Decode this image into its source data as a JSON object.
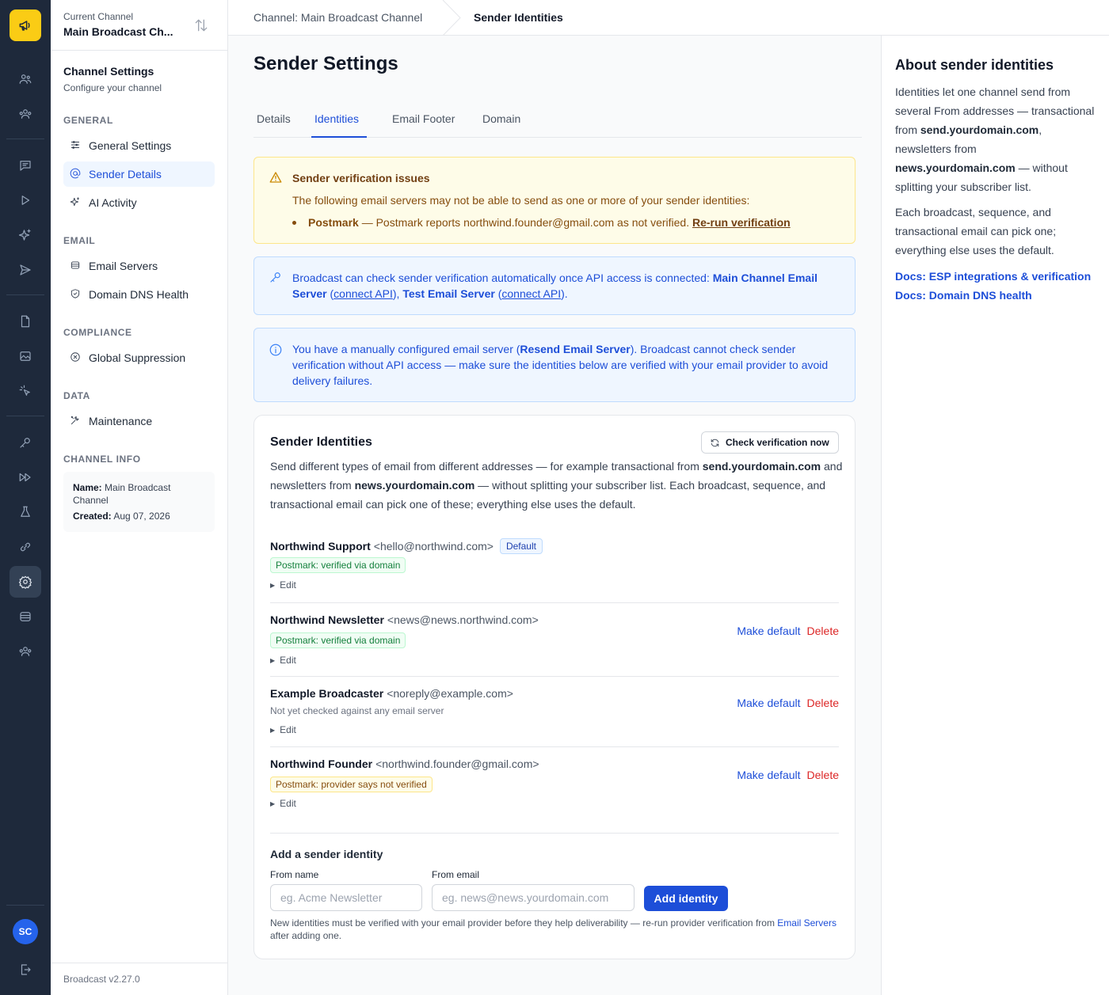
{
  "sidebar": {
    "current_channel_label": "Current Channel",
    "current_channel_name": "Main Broadcast Ch...",
    "settings_title": "Channel Settings",
    "settings_subtitle": "Configure your channel",
    "sections": {
      "general": "GENERAL",
      "email": "EMAIL",
      "compliance": "COMPLIANCE",
      "data": "DATA",
      "channel_info": "CHANNEL INFO"
    },
    "items": {
      "general_settings": "General Settings",
      "sender_details": "Sender Details",
      "ai_activity": "AI Activity",
      "email_servers": "Email Servers",
      "domain_dns_health": "Domain DNS Health",
      "global_suppression": "Global Suppression",
      "maintenance": "Maintenance"
    },
    "channel_info": {
      "name_label": "Name:",
      "name_value": "Main Broadcast Channel",
      "created_label": "Created:",
      "created_value": "Aug 07, 2026"
    },
    "version": "Broadcast v2.27.0"
  },
  "rail": {
    "avatar_initials": "SC",
    "accent_color": "#facc15"
  },
  "breadcrumb": {
    "parent": "Channel: Main Broadcast Channel",
    "current": "Sender Identities"
  },
  "page": {
    "title": "Sender Settings",
    "tabs": [
      "Details",
      "Identities",
      "Email Footer",
      "Domain"
    ],
    "active_tab": "Identities"
  },
  "alerts": {
    "warning": {
      "title": "Sender verification issues",
      "description": "The following email servers may not be able to send as one or more of your sender identities:",
      "server": "Postmark",
      "detail": " — Postmark reports northwind.founder@gmail.com as not verified. ",
      "action": "Re-run verification"
    },
    "api_info": {
      "text_1": "Broadcast can check sender verification automatically once API access is connected: ",
      "server_1": "Main Channel Email Server",
      "link": "connect API",
      "sep": ", ",
      "server_2": "Test Email Server",
      "end": "."
    },
    "manual_info": {
      "text_1": "You have a manually configured email server (",
      "server": "Resend Email Server",
      "text_2": "). Broadcast cannot check sender verification without API access — make sure the identities below are verified with your email provider to avoid delivery failures."
    }
  },
  "identities_card": {
    "title": "Sender Identities",
    "check_button": "Check verification now",
    "desc_1": "Send different types of email from different addresses — for example transactional from ",
    "desc_domain_1": "send.yourdomain.com",
    "desc_2": " and newsletters from ",
    "desc_domain_2": "news.yourdomain.com",
    "desc_3": " — without splitting your subscriber list. Each broadcast, sequence, and transactional email can pick one of these; everything else uses the default.",
    "edit_label": "Edit",
    "make_default_label": "Make default",
    "delete_label": "Delete",
    "default_badge": "Default",
    "identities": [
      {
        "name": "Northwind Support",
        "email": "<hello@northwind.com>",
        "status": "Postmark: verified via domain"
      },
      {
        "name": "Northwind Newsletter",
        "email": "<news@news.northwind.com>",
        "status": "Postmark: verified via domain"
      },
      {
        "name": "Example Broadcaster",
        "email": "<noreply@example.com>",
        "status": "Not yet checked against any email server"
      },
      {
        "name": "Northwind Founder",
        "email": "<northwind.founder@gmail.com>",
        "status": "Postmark: provider says not verified"
      }
    ],
    "add": {
      "title": "Add a sender identity",
      "from_name_label": "From name",
      "from_name_placeholder": "eg. Acme Newsletter",
      "from_email_label": "From email",
      "from_email_placeholder": "eg. news@news.yourdomain.com",
      "button": "Add identity",
      "help_1": "New identities must be verified with your email provider before they help deliverability — re-run provider verification from ",
      "help_link": "Email Servers",
      "help_2": " after adding one."
    }
  },
  "about": {
    "title": "About sender identities",
    "p1_a": "Identities let one channel send from several From addresses — transactional from ",
    "p1_d1": "send.yourdomain.com",
    "p1_b": ", newsletters from ",
    "p1_d2": "news.yourdomain.com",
    "p1_c": " — without splitting your subscriber list.",
    "p2": "Each broadcast, sequence, and transactional email can pick one; everything else uses the default.",
    "link_1": "Docs: ESP integrations & verification",
    "link_2": "Docs: Domain DNS health"
  }
}
